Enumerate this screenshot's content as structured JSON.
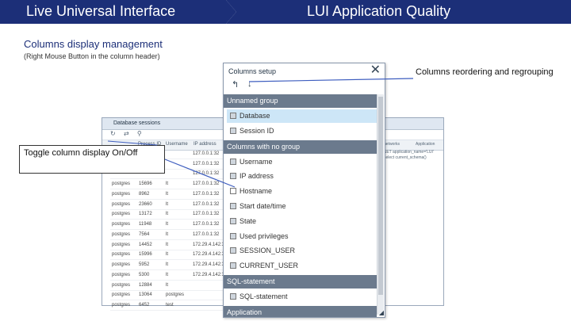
{
  "header": {
    "left_title": "Live Universal Interface",
    "right_title": "LUI Application Quality"
  },
  "section": {
    "title": "Columns display management",
    "note": "(Right Mouse Button in the column header)"
  },
  "background_window": {
    "title": "Database sessions",
    "toolbar_icons": [
      "refresh-icon",
      "sync-icon",
      "filter-icon"
    ],
    "column_headers": [
      "",
      "Process ID",
      "Username",
      "IP address"
    ],
    "rows": [
      [
        "",
        "",
        "",
        "127.0.0.1:32"
      ],
      [
        "",
        "",
        "",
        "127.0.0.1:32"
      ],
      [
        "",
        "",
        "",
        "127.0.0.1:32"
      ],
      [
        "postgres",
        "15696",
        "lt",
        "127.0.0.1:32"
      ],
      [
        "postgres",
        "8962",
        "lt",
        "127.0.0.1:32"
      ],
      [
        "postgres",
        "23660",
        "lt",
        "127.0.0.1:32"
      ],
      [
        "postgres",
        "13172",
        "lt",
        "127.0.0.1:32"
      ],
      [
        "postgres",
        "11948",
        "lt",
        "127.0.0.1:32"
      ],
      [
        "postgres",
        "7564",
        "lt",
        "127.0.0.1:32"
      ],
      [
        "postgres",
        "14452",
        "lt",
        "172.29.4.142:32"
      ],
      [
        "postgres",
        "15996",
        "lt",
        "172.29.4.142:32"
      ],
      [
        "postgres",
        "5952",
        "lt",
        "172.29.4.142:32"
      ],
      [
        "postgres",
        "5300",
        "lt",
        "172.29.4.142:32"
      ],
      [
        "postgres",
        "12884",
        "lt",
        ""
      ],
      [
        "postgres",
        "13064",
        "postgres",
        ""
      ],
      [
        "postgres",
        "6452",
        "test",
        ""
      ]
    ],
    "right_header_1": "networks",
    "right_header_2": "Application",
    "right_text_1": "SET application_name='LUI'",
    "right_text_2": "select current_schema()"
  },
  "dialog": {
    "title": "Columns setup",
    "close_icon": "close-icon",
    "groups": [
      {
        "label": "Unnamed group",
        "items": [
          {
            "label": "Database",
            "checked": true,
            "selected": true
          },
          {
            "label": "Session ID",
            "checked": true
          }
        ]
      },
      {
        "label": "Columns with no group",
        "items": [
          {
            "label": "Username",
            "checked": true
          },
          {
            "label": "IP address",
            "checked": true
          },
          {
            "label": "Hostname",
            "checked": false
          },
          {
            "label": "Start date/time",
            "checked": true
          },
          {
            "label": "State",
            "checked": true
          },
          {
            "label": "Used privileges",
            "checked": true
          },
          {
            "label": "SESSION_USER",
            "checked": true
          },
          {
            "label": "CURRENT_USER",
            "checked": true
          }
        ]
      },
      {
        "label": "SQL-statement",
        "items": [
          {
            "label": "SQL-statement",
            "checked": true
          }
        ]
      },
      {
        "label": "Application",
        "items": []
      }
    ]
  },
  "callouts": {
    "toggle": "Toggle column display On/Off",
    "reorder": "Columns reordering and regrouping"
  },
  "colors": {
    "banner": "#1c2f78",
    "group_header": "#6b7a8d",
    "selected_row": "#cde6f7",
    "callout_line": "#3d5dbf"
  }
}
